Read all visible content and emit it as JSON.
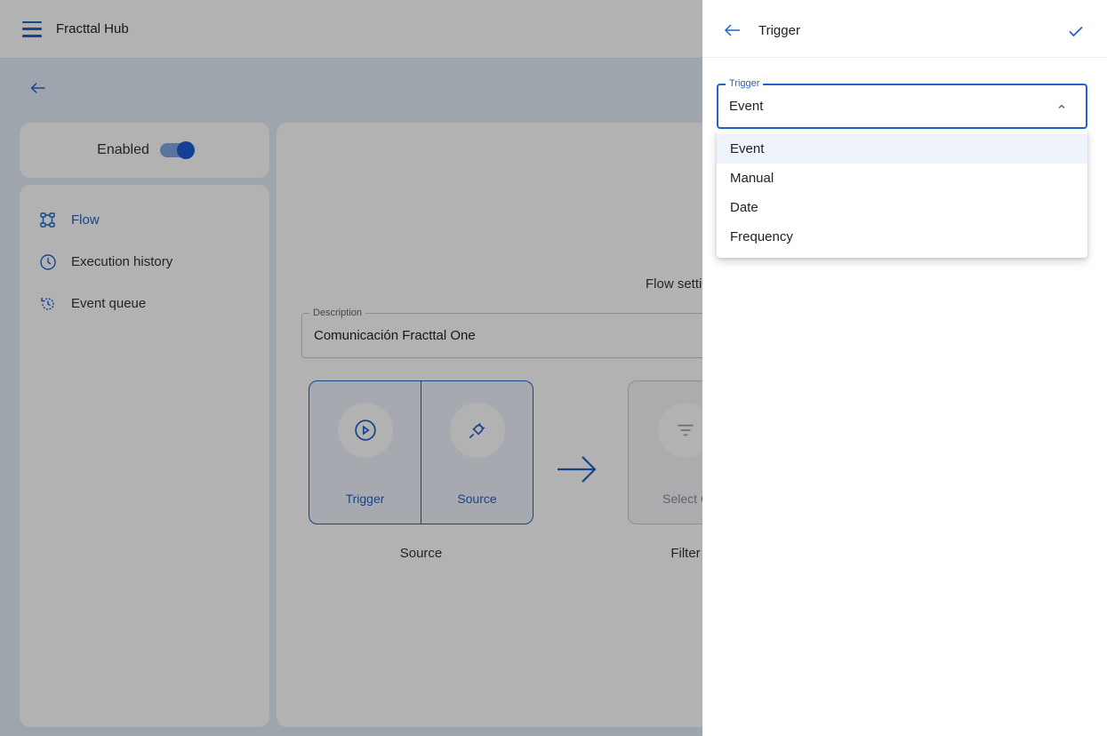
{
  "app": {
    "title": "Fracttal Hub"
  },
  "enabled": {
    "label": "Enabled",
    "value": true
  },
  "sidebar": {
    "items": [
      {
        "label": "Flow",
        "icon": "flow-icon",
        "active": true
      },
      {
        "label": "Execution history",
        "icon": "clock-icon",
        "active": false
      },
      {
        "label": "Event queue",
        "icon": "history-icon",
        "active": false
      }
    ]
  },
  "main": {
    "heading": "Flow setti",
    "description": {
      "legend": "Description",
      "value": "Comunicación Fracttal One"
    },
    "source_box": {
      "trigger_label": "Trigger",
      "source_label": "Source",
      "caption": "Source"
    },
    "filter_box": {
      "label": "Select O",
      "caption": "Filter"
    }
  },
  "panel": {
    "title": "Trigger",
    "select": {
      "legend": "Trigger",
      "value": "Event",
      "options": [
        "Event",
        "Manual",
        "Date",
        "Frequency"
      ],
      "selected_index": 0
    }
  },
  "colors": {
    "accent": "#2163c9",
    "background": "#e4ecf7"
  }
}
